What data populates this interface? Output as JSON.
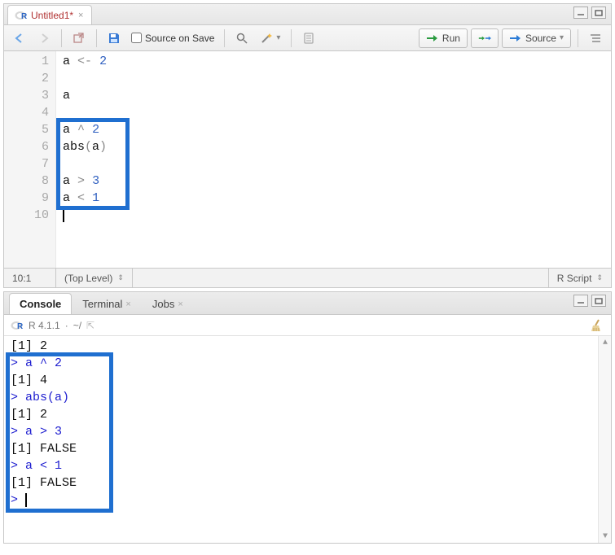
{
  "editor": {
    "tab": {
      "title": "Untitled1*",
      "modified": true
    },
    "toolbar": {
      "source_on_save_label": "Source on Save",
      "run_label": "Run",
      "source_label": "Source"
    },
    "lines": [
      {
        "n": 1,
        "tokens": [
          {
            "t": "a",
            "cls": "id"
          },
          {
            "t": " "
          },
          {
            "t": "<-",
            "cls": "op"
          },
          {
            "t": " "
          },
          {
            "t": "2",
            "cls": "num"
          }
        ]
      },
      {
        "n": 2,
        "tokens": []
      },
      {
        "n": 3,
        "tokens": [
          {
            "t": "a",
            "cls": "id"
          }
        ]
      },
      {
        "n": 4,
        "tokens": []
      },
      {
        "n": 5,
        "tokens": [
          {
            "t": "a",
            "cls": "id"
          },
          {
            "t": " "
          },
          {
            "t": "^",
            "cls": "op"
          },
          {
            "t": " "
          },
          {
            "t": "2",
            "cls": "num"
          }
        ]
      },
      {
        "n": 6,
        "tokens": [
          {
            "t": "abs",
            "cls": "id"
          },
          {
            "t": "(",
            "cls": "op"
          },
          {
            "t": "a",
            "cls": "id"
          },
          {
            "t": ")",
            "cls": "op"
          }
        ]
      },
      {
        "n": 7,
        "tokens": []
      },
      {
        "n": 8,
        "tokens": [
          {
            "t": "a",
            "cls": "id"
          },
          {
            "t": " "
          },
          {
            "t": ">",
            "cls": "op"
          },
          {
            "t": " "
          },
          {
            "t": "3",
            "cls": "num"
          }
        ]
      },
      {
        "n": 9,
        "tokens": [
          {
            "t": "a",
            "cls": "id"
          },
          {
            "t": " "
          },
          {
            "t": "<",
            "cls": "op"
          },
          {
            "t": " "
          },
          {
            "t": "1",
            "cls": "num"
          }
        ]
      },
      {
        "n": 10,
        "tokens": []
      }
    ],
    "highlight_box_lines": {
      "start": 5,
      "end": 9
    },
    "cursor_line": 10,
    "status": {
      "position": "10:1",
      "scope": "(Top Level)",
      "filetype": "R Script"
    }
  },
  "console": {
    "tabs": [
      {
        "label": "Console",
        "active": true,
        "closable": false
      },
      {
        "label": "Terminal",
        "active": false,
        "closable": true
      },
      {
        "label": "Jobs",
        "active": false,
        "closable": true
      }
    ],
    "info": {
      "version": "R 4.1.1",
      "wd": "~/"
    },
    "lines": [
      {
        "kind": "out",
        "text": "[1] 2"
      },
      {
        "kind": "in",
        "text": "> a ^ 2"
      },
      {
        "kind": "out",
        "text": "[1] 4"
      },
      {
        "kind": "in",
        "text": "> abs(a)"
      },
      {
        "kind": "out",
        "text": "[1] 2"
      },
      {
        "kind": "in",
        "text": "> a > 3"
      },
      {
        "kind": "out",
        "text": "[1] FALSE"
      },
      {
        "kind": "in",
        "text": "> a < 1"
      },
      {
        "kind": "out",
        "text": "[1] FALSE"
      },
      {
        "kind": "prompt",
        "text": "> "
      }
    ],
    "highlight_box_lines": {
      "start": 1,
      "end": 9
    }
  }
}
